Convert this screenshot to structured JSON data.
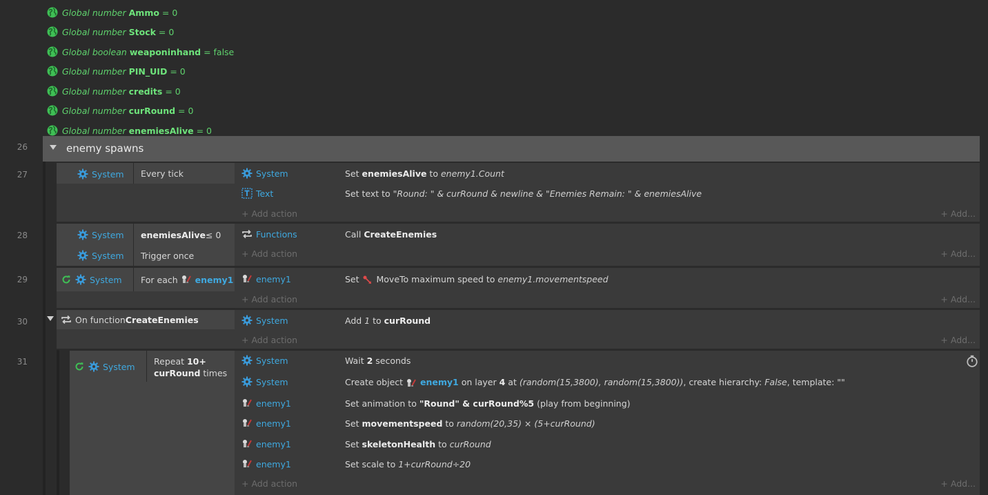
{
  "globals": [
    {
      "type": "Global number",
      "name": "Ammo",
      "value": "= 0"
    },
    {
      "type": "Global number",
      "name": "Stock",
      "value": "= 0"
    },
    {
      "type": "Global boolean",
      "name": "weaponinhand",
      "value": "= false"
    },
    {
      "type": "Global number",
      "name": "PIN_UID",
      "value": "= 0"
    },
    {
      "type": "Global number",
      "name": "credits",
      "value": "= 0"
    },
    {
      "type": "Global number",
      "name": "curRound",
      "value": "= 0"
    },
    {
      "type": "Global number",
      "name": "enemiesAlive",
      "value": "= 0"
    }
  ],
  "group": {
    "line": "26",
    "title": "enemy spawns"
  },
  "labels": {
    "add_action": "Add action",
    "add": "Add...",
    "system": "System",
    "text": "Text",
    "functions": "Functions",
    "enemy1": "enemy1"
  },
  "events": {
    "e27": {
      "line": "27",
      "cond": "Every tick",
      "a1": {
        "pre": "Set ",
        "b": "enemiesAlive",
        "mid": " to ",
        "i": "enemy1.Count"
      },
      "a2": {
        "pre": "Set text to ",
        "i": "\"Round: \" & curRound & newline & \"Enemies Remain: \" & enemiesAlive"
      }
    },
    "e28": {
      "line": "28",
      "cond1_b": "enemiesAlive",
      "cond1_rest": " ≤ 0",
      "cond2": "Trigger once",
      "a1": {
        "pre": "Call ",
        "b": "CreateEnemies"
      }
    },
    "e29": {
      "line": "29",
      "cond_pre": "For each",
      "cond_obj": "enemy1",
      "a1": {
        "pre": "Set ",
        "mid": "MoveTo maximum speed to ",
        "i": "enemy1.movementspeed"
      }
    },
    "e30": {
      "line": "30",
      "cond_pre": "On function ",
      "cond_b": "CreateEnemies",
      "a1": {
        "pre": "Add ",
        "i": "1",
        "mid": " to ",
        "b": "curRound"
      }
    },
    "e31": {
      "line": "31",
      "cond_pre": "Repeat ",
      "cond_b1": "10+",
      "cond_b2": "curRound",
      "cond_post": " times",
      "a1": {
        "pre": "Wait ",
        "b": "2",
        "post": " seconds"
      },
      "a2": {
        "pre": "Create object ",
        "obj": "enemy1",
        "mid": " on layer ",
        "b": "4",
        "at": " at ",
        "i": "(random(15,3800), random(15,3800))",
        "post": ", create hierarchy: ",
        "i2": "False",
        "post2": ", template: \"\""
      },
      "a3": {
        "pre": "Set animation to ",
        "b": "\"Round\" & curRound%5",
        "post": " (play from beginning)"
      },
      "a4": {
        "pre": "Set ",
        "b": "movementspeed",
        "mid": " to ",
        "i": "random(20,35) × (5+curRound)"
      },
      "a5": {
        "pre": "Set ",
        "b": "skeletonHealth",
        "mid": " to ",
        "i": "curRound"
      },
      "a6": {
        "pre": "Set scale to ",
        "i": "1+curRound÷20"
      }
    }
  }
}
